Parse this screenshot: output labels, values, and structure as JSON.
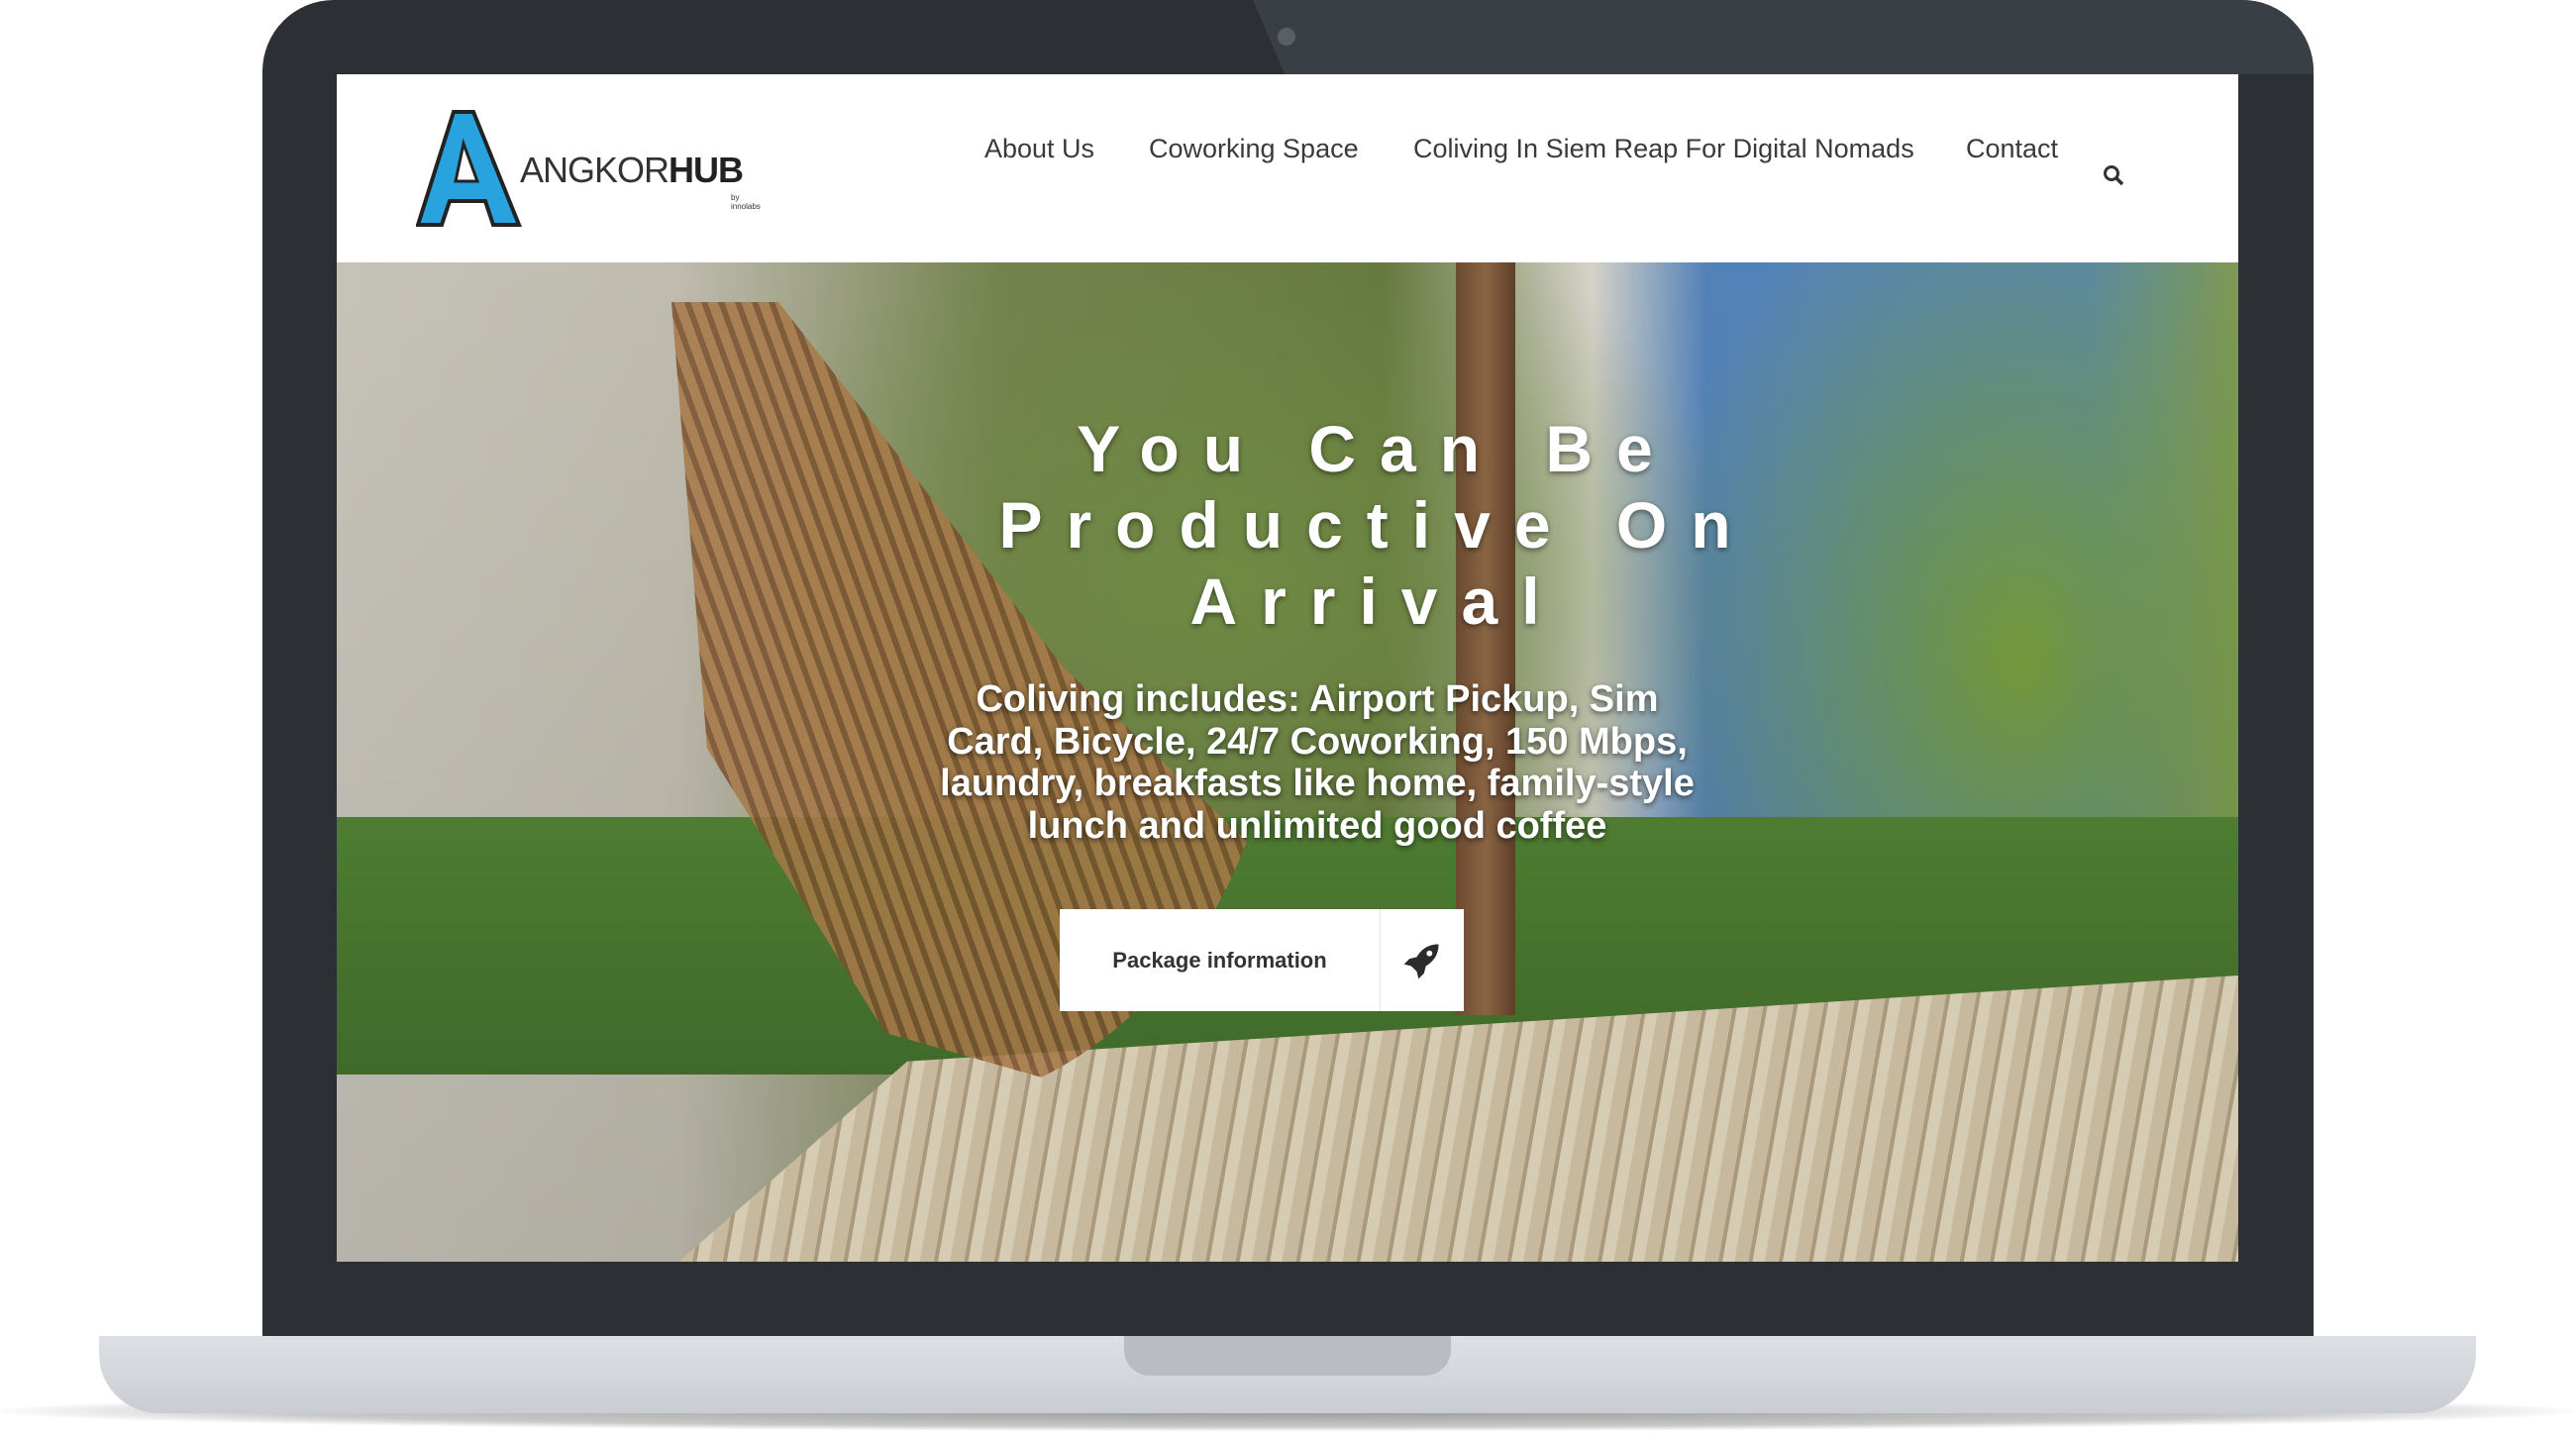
{
  "brand": {
    "name_light": "ANGKOR",
    "name_bold": "HUB",
    "byline": "by innolabs",
    "logo_letter": "A",
    "logo_color": "#29a3de"
  },
  "nav": {
    "items": [
      {
        "label": "About Us"
      },
      {
        "label": "Coworking Space"
      },
      {
        "label": "Coliving In Siem Reap For Digital Nomads"
      },
      {
        "label": "Contact"
      }
    ],
    "search_icon": "search-icon"
  },
  "hero": {
    "headline_lines": [
      "You Can Be",
      "Productive On",
      "Arrival"
    ],
    "subtitle_lines": [
      "Coliving includes: Airport Pickup, Sim",
      "Card, Bicycle, 24/7 Coworking, 150 Mbps,",
      "laundry, breakfasts like home, family-style",
      "lunch and unlimited good coffee"
    ],
    "cta": {
      "label": "Package information",
      "icon": "rocket-icon"
    }
  }
}
